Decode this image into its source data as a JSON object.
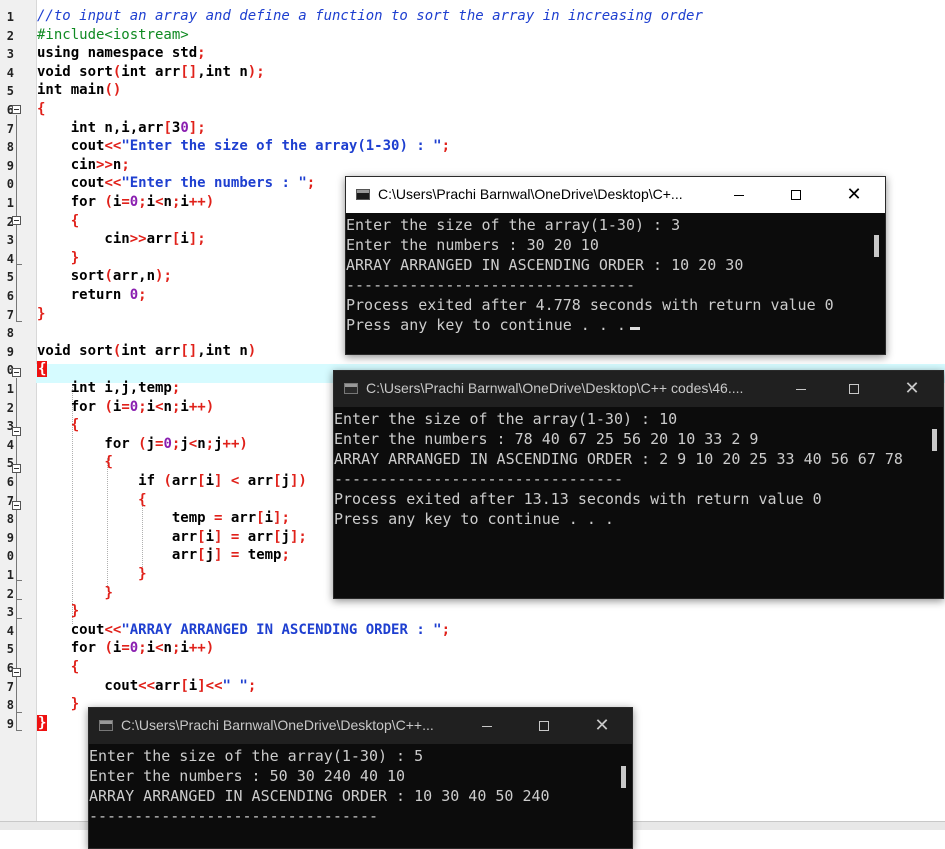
{
  "editor": {
    "gutter_numbers": [
      "1",
      "2",
      "3",
      "4",
      "5",
      "6",
      "7",
      "8",
      "9",
      "0",
      "1",
      "2",
      "3",
      "4",
      "5",
      "6",
      "7",
      "8",
      "9",
      "0",
      "1",
      "2",
      "3",
      "4",
      "5",
      "6",
      "7",
      "8",
      "9",
      "0",
      "1",
      "2",
      "3",
      "4",
      "5",
      "6",
      "7",
      "8",
      "9"
    ],
    "lines": [
      "//to input an array and define a function to sort the array in increasing order",
      "#include<iostream>",
      "using namespace std;",
      "void sort(int arr[],int n);",
      "int main()",
      "{",
      "    int n,i,arr[30];",
      "    cout<<\"Enter the size of the array(1-30) : \";",
      "    cin>>n;",
      "    cout<<\"Enter the numbers : \";",
      "    for (i=0;i<n;i++)",
      "    {",
      "        cin>>arr[i];",
      "    }",
      "    sort(arr,n);",
      "    return 0;",
      "}",
      "",
      "void sort(int arr[],int n)",
      "{",
      "    int i,j,temp;",
      "    for (i=0;i<n;i++)",
      "    {",
      "        for (j=0;j<n;j++)",
      "        {",
      "            if (arr[i] < arr[j])",
      "            {",
      "                temp = arr[i];",
      "                arr[i] = arr[j];",
      "                arr[j] = temp;",
      "            }",
      "        }",
      "    }",
      "    cout<<\"ARRAY ARRANGED IN ASCENDING ORDER : \";",
      "    for (i=0;i<n;i++)",
      "    {",
      "        cout<<arr[i]<<\" \";",
      "    }",
      "}"
    ]
  },
  "consoles": [
    {
      "title": "C:\\Users\\Prachi Barnwal\\OneDrive\\Desktop\\C+...",
      "lines": [
        "Enter the size of the array(1-30) : 3",
        "Enter the numbers : 30 20 10",
        "ARRAY ARRANGED IN ASCENDING ORDER : 10 20 30",
        "--------------------------------",
        "Process exited after 4.778 seconds with return value 0",
        "Press any key to continue . . ."
      ]
    },
    {
      "title": "C:\\Users\\Prachi Barnwal\\OneDrive\\Desktop\\C++ codes\\46....",
      "lines": [
        "Enter the size of the array(1-30) : 10",
        "Enter the numbers : 78 40 67 25 56 20 10 33 2 9",
        "ARRAY ARRANGED IN ASCENDING ORDER : 2 9 10 20 25 33 40 56 67 78",
        "--------------------------------",
        "Process exited after 13.13 seconds with return value 0",
        "Press any key to continue . . ."
      ]
    },
    {
      "title": "C:\\Users\\Prachi Barnwal\\OneDrive\\Desktop\\C++...",
      "lines": [
        "Enter the size of the array(1-30) : 5",
        "Enter the numbers : 50 30 240 40 10",
        "ARRAY ARRANGED IN ASCENDING ORDER : 10 30 40 50 240",
        "--------------------------------"
      ]
    }
  ],
  "window_buttons": {
    "minimize": "—",
    "maximize": "☐",
    "close": "✕"
  },
  "colors": {
    "comment": "#1e3fd0",
    "preprocessor": "#0f8a22",
    "string": "#1e3fd0",
    "operator": "#e0211a",
    "number": "#8a1fb0",
    "highlight_row": "#d6fbff",
    "console_bg": "#0c0c0c",
    "console_text": "#cccccc"
  }
}
